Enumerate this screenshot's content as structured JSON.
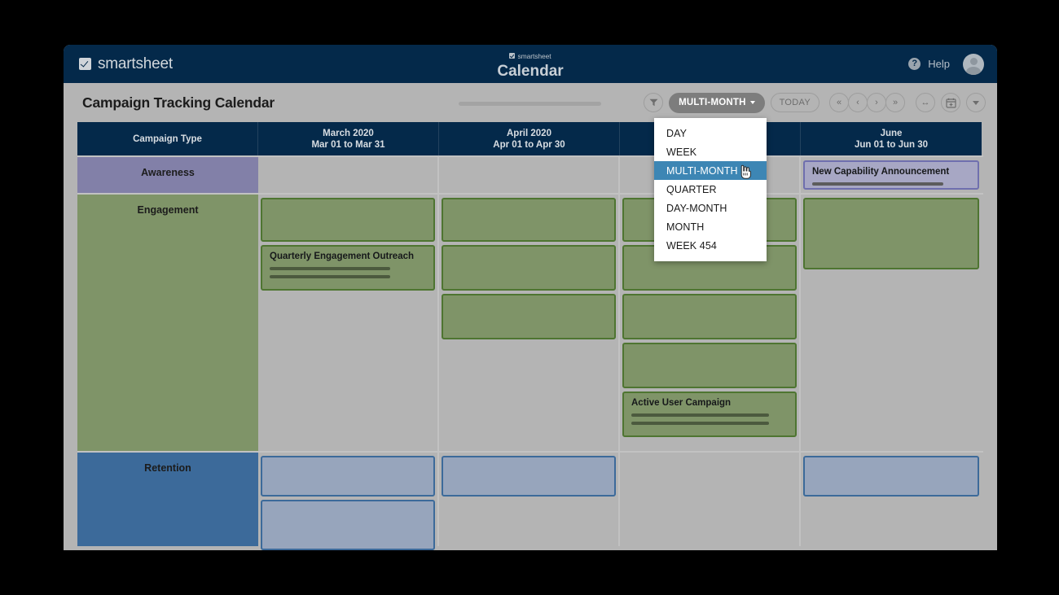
{
  "topbar": {
    "brand": "smartsheet",
    "center_logo": "smartsheet",
    "center_app": "Calendar",
    "help_glyph": "?",
    "help_label": "Help",
    "avatar_name": "user-avatar"
  },
  "toolbar": {
    "doc_title": "Campaign Tracking Calendar",
    "filter_label": "",
    "view_button": "MULTI-MONTH",
    "today_button": "TODAY",
    "nav": {
      "first": "«",
      "prev": "‹",
      "next": "›",
      "last": "»",
      "fit": "↔",
      "datepicker": "calendar-plus",
      "more": "▾"
    }
  },
  "dropdown": {
    "open": true,
    "selected": "MULTI-MONTH",
    "items": [
      "DAY",
      "WEEK",
      "MULTI-MONTH",
      "QUARTER",
      "DAY-MONTH",
      "MONTH",
      "WEEK 454"
    ]
  },
  "calendar": {
    "columns": [
      {
        "title": "Campaign Type",
        "subtitle": ""
      },
      {
        "title": "March 2020",
        "subtitle": "Mar 01 to Mar 31"
      },
      {
        "title": "April 2020",
        "subtitle": "Apr 01 to Apr 30"
      },
      {
        "title": "",
        "subtitle": ""
      },
      {
        "title": "June",
        "subtitle": "Jun 01 to Jun 30"
      }
    ],
    "rows": [
      {
        "label": "Awareness",
        "cells": [
          {
            "events": []
          },
          {
            "events": []
          },
          {
            "events": []
          },
          {
            "events": [
              {
                "title": "New Capability Announcement",
                "lines": 1
              }
            ]
          }
        ]
      },
      {
        "label": "Engagement",
        "cells": [
          {
            "events": [
              {
                "title": "",
                "lines": 0
              },
              {
                "title": "Quarterly Engagement Outreach",
                "lines": 2
              }
            ]
          },
          {
            "events": [
              {
                "title": "",
                "lines": 0
              },
              {
                "title": "",
                "lines": 0
              },
              {
                "title": "",
                "lines": 0
              }
            ]
          },
          {
            "events": [
              {
                "title": "",
                "lines": 0
              },
              {
                "title": "",
                "lines": 0
              },
              {
                "title": "",
                "lines": 0
              },
              {
                "title": "",
                "lines": 0
              },
              {
                "title": "Active User Campaign",
                "lines": 2
              }
            ]
          },
          {
            "events": [
              {
                "title": "",
                "lines": 0
              }
            ]
          }
        ]
      },
      {
        "label": "Retention",
        "cells": [
          {
            "events": [
              {
                "title": "",
                "lines": 0
              },
              {
                "title": "",
                "lines": 0
              }
            ]
          },
          {
            "events": [
              {
                "title": "",
                "lines": 0
              }
            ]
          },
          {
            "events": []
          },
          {
            "events": [
              {
                "title": "",
                "lines": 0
              }
            ]
          }
        ]
      }
    ]
  },
  "colors": {
    "nav_navy": "#04294a",
    "toolbar_gray": "#b4b4b4",
    "awareness_purple": "#8280a8",
    "engagement_green": "#7f9468",
    "retention_blue": "#3c6a9a",
    "menu_highlight": "#3d86b4",
    "active_button_gray": "#7d7d7d"
  }
}
